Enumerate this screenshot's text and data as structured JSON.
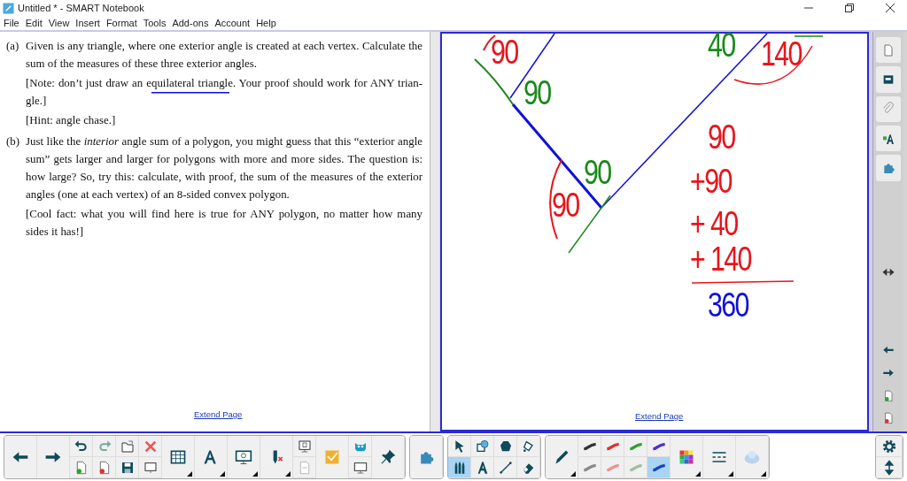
{
  "window": {
    "title": "Untitled * - SMART Notebook"
  },
  "menu": [
    "File",
    "Edit",
    "View",
    "Insert",
    "Format",
    "Tools",
    "Add-ons",
    "Account",
    "Help"
  ],
  "left_page": {
    "items": [
      {
        "label": "(a)",
        "paragraphs": [
          "Given is any triangle, where one exterior angle is created at each vertex. Calculate the sum of the measures of these three exterior angles.",
          "[Note: don’t just draw an equilateral triangle. Your proof should work for ANY trian-gle.]",
          "[Hint: angle chase.]"
        ]
      },
      {
        "label": "(b)",
        "paragraphs": [
          "Just like the *interior* angle sum of a polygon, you might guess that this “exterior angle sum” gets larger and larger for polygons with more and more sides. The question is: how large? So, try this: calculate, with proof, the sum of the measures of the exterior angles (one at each vertex) of an 8-sided convex polygon.",
          "[Cool fact: what you will find here is true for ANY polygon, no matter how many sides it has!]"
        ]
      }
    ],
    "link": "Extend Page"
  },
  "right_page": {
    "ink": [
      {
        "text": "90",
        "color": "#e8141c"
      },
      {
        "text": "90",
        "color": "#1a8a1a"
      },
      {
        "text": "40",
        "color": "#1a8a1a"
      },
      {
        "text": "140",
        "color": "#e8141c"
      },
      {
        "text": "90",
        "color": "#1a8a1a"
      },
      {
        "text": "90",
        "color": "#e8141c"
      },
      {
        "text": "90",
        "color": "#e8141c"
      },
      {
        "text": "+90",
        "color": "#e8141c"
      },
      {
        "text": "+ 40",
        "color": "#e8141c"
      },
      {
        "text": "+ 140",
        "color": "#e8141c"
      },
      {
        "text": "360",
        "color": "#1010d8"
      }
    ],
    "link": "Extend Page"
  },
  "select_tools": [
    {
      "selected": false
    },
    {
      "selected": false
    },
    {
      "selected": false
    },
    {
      "selected": false
    },
    {
      "selected": true
    },
    {
      "selected": false
    },
    {
      "selected": false
    },
    {
      "selected": false
    }
  ],
  "pen_styles": [
    {
      "color": "#333333",
      "selected": false
    },
    {
      "color": "#e03030",
      "selected": false
    },
    {
      "color": "#30a030",
      "selected": false
    },
    {
      "color": "#5030d0",
      "selected": false
    },
    {
      "color": "#888888",
      "selected": false
    },
    {
      "color": "#f09090",
      "selected": false
    },
    {
      "color": "#a0c0a0",
      "selected": false
    },
    {
      "color": "#2040c0",
      "selected": true
    }
  ]
}
